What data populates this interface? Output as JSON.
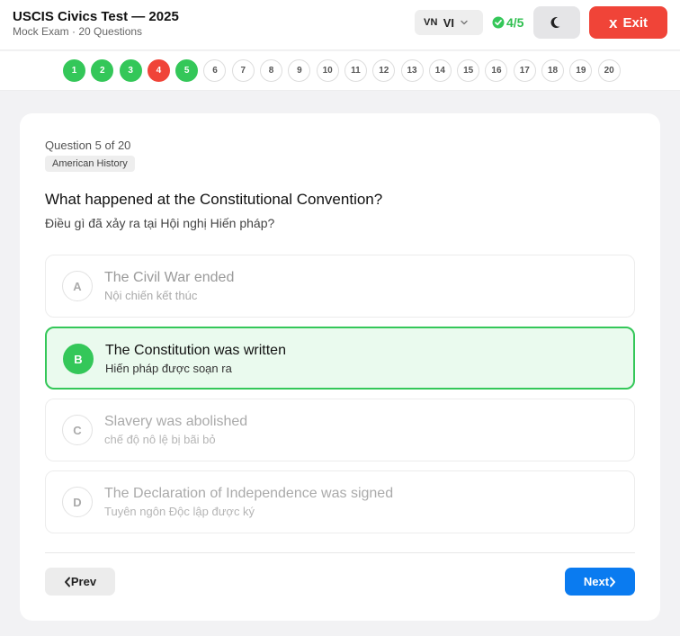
{
  "header": {
    "title": "USCIS Civics Test — 2025",
    "subtitle": "Mock Exam · 20 Questions",
    "language": {
      "flag": "VN",
      "code": "VI",
      "icon": "chevron-down-icon"
    },
    "score": {
      "text": "4/5",
      "icon": "check-circle-icon"
    },
    "theme_icon": "moon-icon",
    "exit_label": "Exit",
    "exit_icon": "x"
  },
  "progress": {
    "dots": [
      {
        "label": "1",
        "state": "correct"
      },
      {
        "label": "2",
        "state": "correct"
      },
      {
        "label": "3",
        "state": "correct"
      },
      {
        "label": "4",
        "state": "wrong"
      },
      {
        "label": "5",
        "state": "correct"
      },
      {
        "label": "6",
        "state": "pending"
      },
      {
        "label": "7",
        "state": "pending"
      },
      {
        "label": "8",
        "state": "pending"
      },
      {
        "label": "9",
        "state": "pending"
      },
      {
        "label": "10",
        "state": "pending"
      },
      {
        "label": "11",
        "state": "pending"
      },
      {
        "label": "12",
        "state": "pending"
      },
      {
        "label": "13",
        "state": "pending"
      },
      {
        "label": "14",
        "state": "pending"
      },
      {
        "label": "15",
        "state": "pending"
      },
      {
        "label": "16",
        "state": "pending"
      },
      {
        "label": "17",
        "state": "pending"
      },
      {
        "label": "18",
        "state": "pending"
      },
      {
        "label": "19",
        "state": "pending"
      },
      {
        "label": "20",
        "state": "pending"
      }
    ]
  },
  "question": {
    "counter": "Question 5 of 20",
    "category": "American History",
    "text_en": "What happened at the Constitutional Convention?",
    "text_vi": "Điều gì đã xảy ra tại Hội nghị Hiến pháp?",
    "options": [
      {
        "letter": "A",
        "en": "The Civil War ended",
        "vi": "Nội chiến kết thúc",
        "state": "neutral"
      },
      {
        "letter": "B",
        "en": "The Constitution was written",
        "vi": "Hiến pháp được soạn ra",
        "state": "selected"
      },
      {
        "letter": "C",
        "en": "Slavery was abolished",
        "vi": "chế độ nô lệ bị bãi bỏ",
        "state": "dim"
      },
      {
        "letter": "D",
        "en": "The Declaration of Independence was signed",
        "vi": "Tuyên ngôn Độc lập được ký",
        "state": "dim"
      }
    ]
  },
  "nav": {
    "prev_label": "Prev",
    "next_label": "Next"
  },
  "colors": {
    "correct": "#34c759",
    "wrong": "#f04438",
    "primary": "#0a7bf0",
    "exit": "#f04438"
  }
}
